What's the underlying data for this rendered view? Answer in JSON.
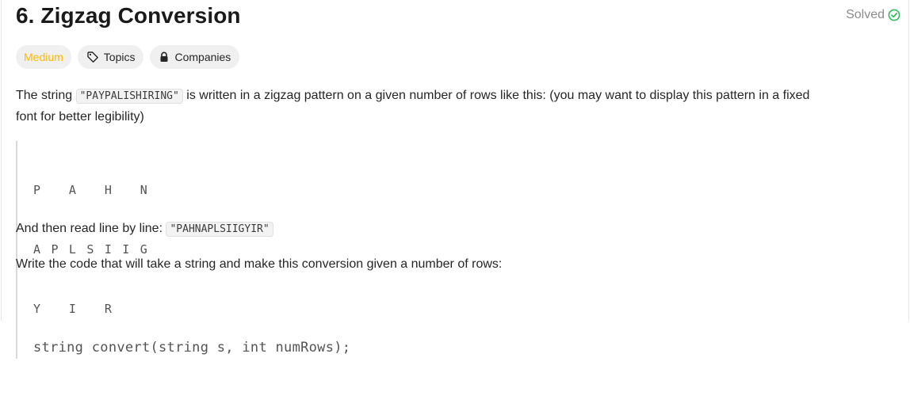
{
  "problem": {
    "title": "6. Zigzag Conversion",
    "status": "Solved"
  },
  "tags": {
    "difficulty": "Medium",
    "topics": "Topics",
    "companies": "Companies"
  },
  "description": {
    "p1_before": "The string ",
    "p1_code": "\"PAYPALISHIRING\"",
    "p1_after_line1": " is written in a zigzag pattern on a given number of rows like this: (you may want to display this pattern in a fixed",
    "p1_line2": "font for better legibility)",
    "zigzag_lines": [
      "P   A   H   N",
      "A P L S I I G",
      "Y   I   R"
    ],
    "p2_before": "And then read line by line: ",
    "p2_code": "\"PAHNAPLSIIGYIR\"",
    "p3": "Write the code that will take a string and make this conversion given a number of rows:",
    "signature": "string convert(string s, int numRows);"
  },
  "colors": {
    "difficulty_medium": "#ffb800",
    "solved_check": "#2cbb5d"
  },
  "icons": {
    "solved": "check-circle-icon",
    "topics": "tag-icon",
    "companies": "lock-icon"
  }
}
